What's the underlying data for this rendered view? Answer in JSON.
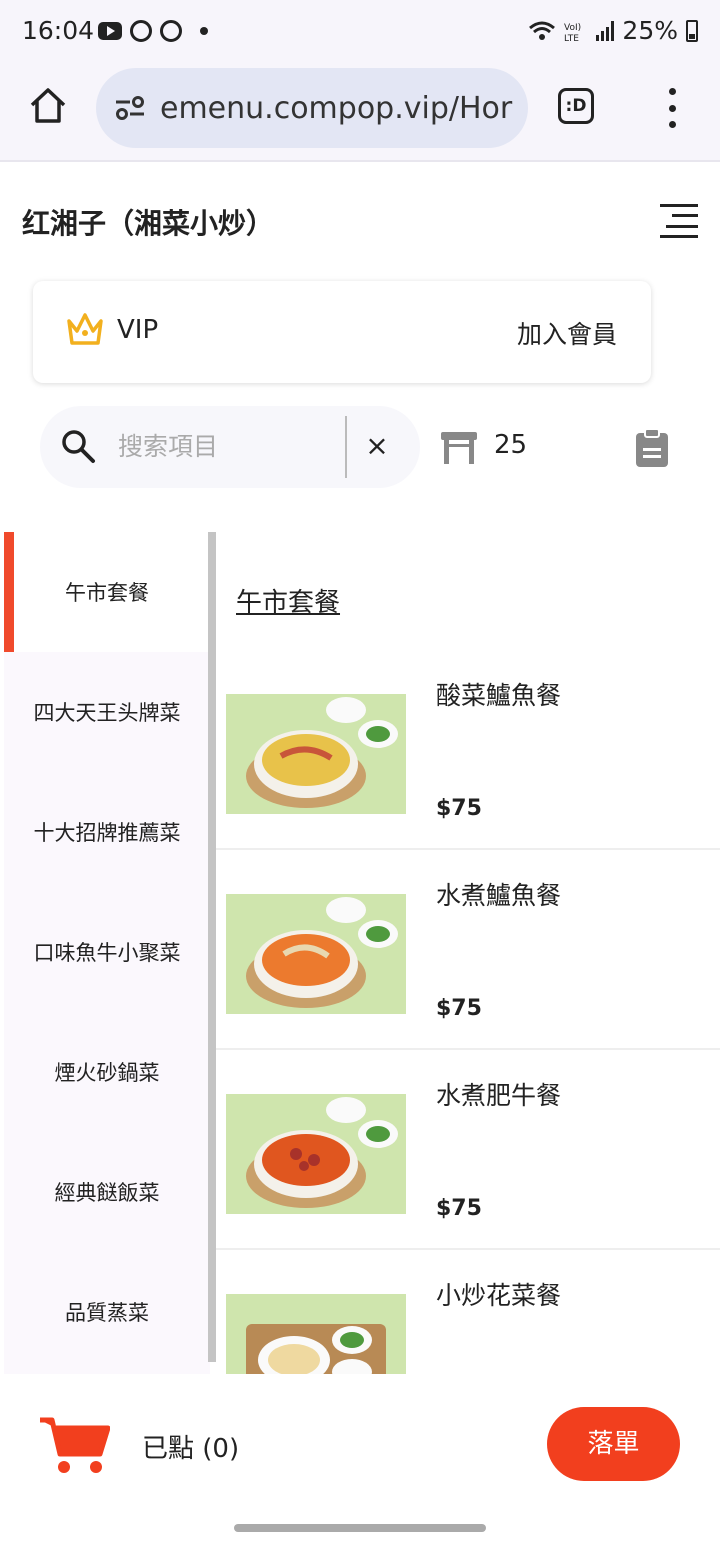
{
  "status_bar": {
    "time": "16:04",
    "battery": "25%"
  },
  "browser": {
    "url": "emenu.compop.vip/Hor",
    "tab_label": ":D"
  },
  "header": {
    "title": "红湘子（湘菜小炒）"
  },
  "vip": {
    "label": "VIP",
    "join_label": "加入會員"
  },
  "search": {
    "placeholder": "搜索項目",
    "clear": "×"
  },
  "table": {
    "number": "25"
  },
  "categories": [
    {
      "label": "午市套餐",
      "active": true
    },
    {
      "label": "四大天王头牌菜"
    },
    {
      "label": "十大招牌推薦菜"
    },
    {
      "label": "口味魚牛小聚菜"
    },
    {
      "label": "煙火砂鍋菜"
    },
    {
      "label": "經典餸飯菜"
    },
    {
      "label": "品質蒸菜"
    }
  ],
  "section": {
    "title": "午市套餐"
  },
  "dishes": [
    {
      "name": "酸菜鱸魚餐",
      "price": "$75"
    },
    {
      "name": "水煮鱸魚餐",
      "price": "$75"
    },
    {
      "name": "水煮肥牛餐",
      "price": "$75"
    },
    {
      "name": "小炒花菜餐",
      "price": ""
    }
  ],
  "cart": {
    "ordered_label": "已點 (0)",
    "submit_label": "落單"
  },
  "colors": {
    "accent": "#f23f1e",
    "vip_gold": "#f2b01e",
    "dish_bg": "#cfe5ad"
  }
}
